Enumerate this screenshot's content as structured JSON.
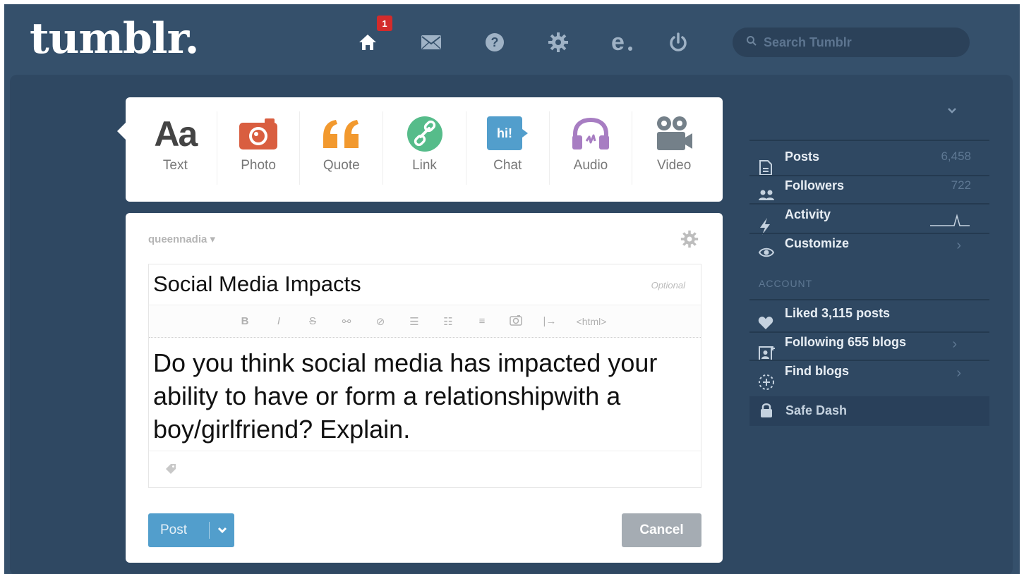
{
  "header": {
    "logo": "tumblr.",
    "home_badge": "1",
    "search_placeholder": "Search Tumblr",
    "nav_icons": [
      "home-icon",
      "mail-icon",
      "help-icon",
      "gear-icon",
      "editor-icon",
      "power-icon"
    ]
  },
  "post_types": [
    {
      "label": "Text",
      "icon": "text-icon",
      "color": "#444444"
    },
    {
      "label": "Photo",
      "icon": "camera-icon",
      "color": "#d95e40"
    },
    {
      "label": "Quote",
      "icon": "quote-icon",
      "color": "#f2992e"
    },
    {
      "label": "Link",
      "icon": "link-icon",
      "color": "#56bc8a"
    },
    {
      "label": "Chat",
      "icon": "chat-icon",
      "color": "#529ecc"
    },
    {
      "label": "Audio",
      "icon": "headphones-icon",
      "color": "#a77dc2"
    },
    {
      "label": "Video",
      "icon": "video-icon",
      "color": "#748089"
    }
  ],
  "editor": {
    "blog_name": "queennadia ▾",
    "title": "Social Media Impacts",
    "title_hint": "Optional",
    "toolbar": [
      "B",
      "I",
      "S",
      "<html>"
    ],
    "body": "Do you think social media has impacted your ability to have or form a relationshipwith a boy/girlfriend? Explain.",
    "post_label": "Post",
    "cancel_label": "Cancel"
  },
  "sidebar": {
    "items": [
      {
        "label": "Posts",
        "value": "6,458"
      },
      {
        "label": "Followers",
        "value": "722"
      },
      {
        "label": "Activity",
        "value": ""
      },
      {
        "label": "Customize",
        "value": "›"
      }
    ],
    "account_heading": "ACCOUNT",
    "account_items": [
      {
        "label": "Liked 3,115 posts",
        "value": ""
      },
      {
        "label": "Following 655 blogs",
        "value": "›"
      },
      {
        "label": "Find blogs",
        "value": "›"
      }
    ],
    "safe_dash": "Safe Dash"
  },
  "colors": {
    "background": "#35506b",
    "panel": "#2f4862",
    "post_button": "#529ecc",
    "cancel_button": "#a5acb3",
    "badge": "#d32b2b"
  }
}
